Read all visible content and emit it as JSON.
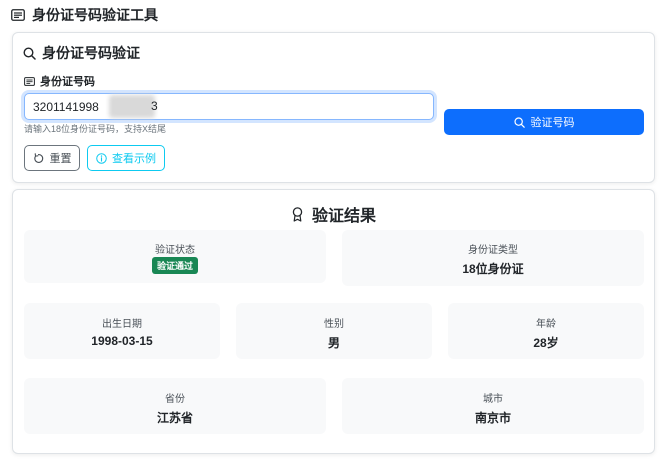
{
  "page": {
    "title": "身份证号码验证工具",
    "title_icon": "id-card-icon"
  },
  "form": {
    "title": "身份证号码验证",
    "title_icon": "search-icon",
    "field_label": "身份证号码",
    "field_icon": "id-card-icon",
    "input_value": "3201141998",
    "input_visible_suffix": "3",
    "hint": "请输入18位身份证号码，支持X结尾",
    "verify_button": "验证号码",
    "reset_button": "重置",
    "example_button": "查看示例"
  },
  "result": {
    "title": "验证结果",
    "title_icon": "award-icon",
    "status_label": "验证状态",
    "status_badge": "验证通过",
    "type_label": "身份证类型",
    "type_value": "18位身份证",
    "birth_label": "出生日期",
    "birth_value": "1998-03-15",
    "gender_label": "性别",
    "gender_value": "男",
    "age_label": "年龄",
    "age_value": "28岁",
    "province_label": "省份",
    "province_value": "江苏省",
    "city_label": "城市",
    "city_value": "南京市"
  },
  "colors": {
    "primary": "#0d6efd",
    "info": "#0dcaf0",
    "success": "#198754",
    "tile_bg": "#f8f9fa"
  }
}
